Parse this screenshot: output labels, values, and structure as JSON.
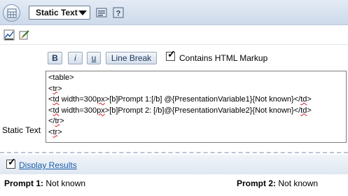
{
  "header": {
    "view_type_value": "Static Text",
    "icons": [
      "view-circle-icon",
      "properties-icon",
      "help-icon"
    ]
  },
  "toolbar2": {
    "icons": [
      "chart-icon",
      "edit-icon"
    ]
  },
  "format_buttons": {
    "bold_label": "B",
    "italic_label": "i",
    "underline_label": "u",
    "line_break_label": "Line Break"
  },
  "html_markup": {
    "label": "Contains HTML Markup",
    "checked": true
  },
  "static_text": {
    "label": "Static Text",
    "lines": [
      "<table>",
      "<tr>",
      "<td width=300px>[b]Prompt 1:[/b] @{PresentationVariable1}{Not known}</td>",
      "<td width=300px>[b]Prompt 2: [/b]@{PresentationVariable2}{Not known}</td>",
      "</tr>",
      "<tr>"
    ]
  },
  "display_results": {
    "label": "Display Results",
    "checked": true
  },
  "results": [
    {
      "prompt_label": "Prompt 1:",
      "value": "Not known"
    },
    {
      "prompt_label": "Prompt 2:",
      "value": "Not known"
    }
  ],
  "colors": {
    "link": "#1a5fa8",
    "header_gradient_top": "#e3ebf5",
    "header_gradient_bottom": "#cddaea"
  }
}
